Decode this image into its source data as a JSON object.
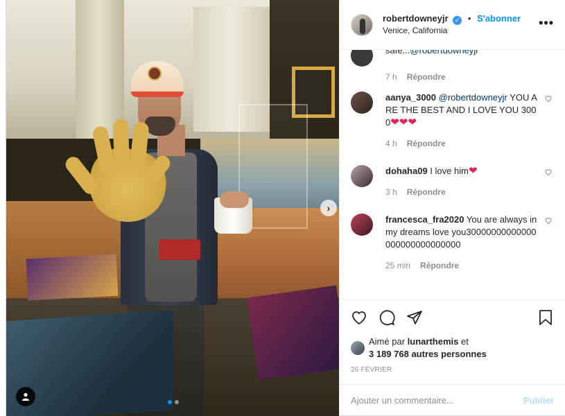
{
  "post": {
    "username": "robertdowneyjr",
    "verified_glyph": "✓",
    "separator": "•",
    "follow_label": "S'abonner",
    "location": "Venice, California",
    "more_label": "•••"
  },
  "comments": [
    {
      "user": "",
      "text": "safe...",
      "mention": "@robertdowneyjr",
      "time": "7 h",
      "reply": "Répondre",
      "avatar_color": "#3a3a3a",
      "partial": true
    },
    {
      "user": "aanya_3000",
      "mention": "@robertdowneyjr",
      "text": "YOU ARE THE BEST AND I LOVE YOU 3000",
      "hearts": "❤❤❤",
      "time": "4 h",
      "reply": "Répondre",
      "avatar_color": "#4a3b33"
    },
    {
      "user": "dohaha09",
      "text": "I love him",
      "hearts": "❤",
      "time": "3 h",
      "reply": "Répondre",
      "avatar_color": "#5a4a52"
    },
    {
      "user": "francesca_fra2020",
      "text": "You are always in my dreams love you30000000000000000000000000000",
      "time": "25 min",
      "reply": "Répondre",
      "avatar_color": "#6a2a3a"
    }
  ],
  "likes": {
    "prefix": "Aimé par",
    "user": "lunarthemis",
    "conj": "et",
    "count_text": "3 189 768 autres personnes"
  },
  "date": "26 FÉVRIER",
  "add_comment": {
    "placeholder": "Ajouter un commentaire...",
    "publish_label": "Publier"
  },
  "carousel": {
    "next_glyph": "›",
    "slides": 2,
    "active_slide": 1
  },
  "colors": {
    "link": "#0095f6",
    "heart": "#ed4956",
    "publish_disabled": "#b2dffc"
  }
}
